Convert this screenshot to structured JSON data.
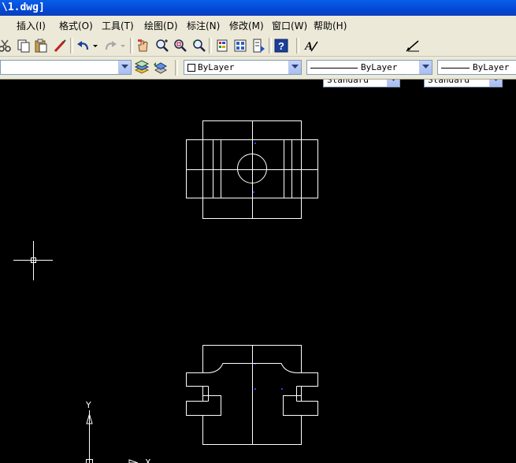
{
  "window": {
    "title": "\\1.dwg]"
  },
  "menu": [
    {
      "label": "插入(I)"
    },
    {
      "label": "格式(O)"
    },
    {
      "label": "工具(T)"
    },
    {
      "label": "绘图(D)"
    },
    {
      "label": "标注(N)"
    },
    {
      "label": "修改(M)"
    },
    {
      "label": "窗口(W)"
    },
    {
      "label": "帮助(H)"
    }
  ],
  "styles": {
    "text_style": "Standard",
    "dim_style": "Standard"
  },
  "properties": {
    "layer": "",
    "color": "ByLayer",
    "linetype": "ByLayer",
    "lineweight": "ByLayer"
  },
  "icons": [
    "cut-icon",
    "copy-icon",
    "paste-icon",
    "match-properties-icon",
    "undo-icon",
    "redo-icon",
    "pan-icon",
    "zoom-realtime-icon",
    "zoom-window-icon",
    "zoom-previous-icon",
    "properties-icon",
    "design-center-icon",
    "tool-palettes-icon",
    "help-icon",
    "text-style-icon",
    "dim-style-icon",
    "layer-manager-icon",
    "layer-previous-icon"
  ],
  "canvas": {
    "background": "#000000",
    "line_color": "#ffffff",
    "ucs_labels": {
      "y": "Y",
      "x": "X"
    }
  }
}
